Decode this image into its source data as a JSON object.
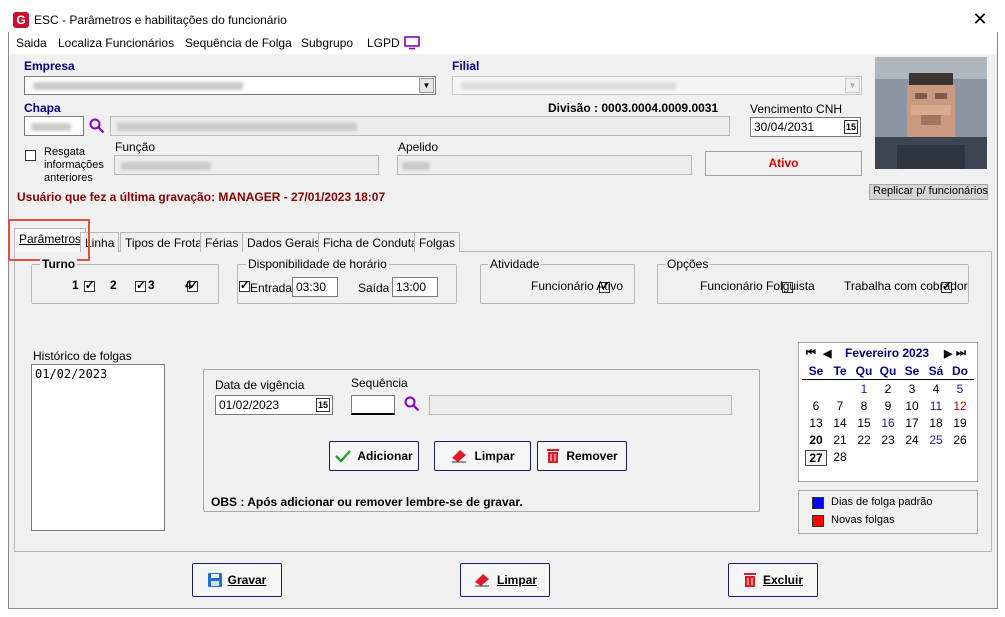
{
  "window": {
    "title": "ESC - Parâmetros e habilitações do funcionário",
    "logo": "G"
  },
  "menu": [
    {
      "label": "Saida"
    },
    {
      "label": "Localiza Funcionários"
    },
    {
      "label": "Sequência de Folga"
    },
    {
      "label": "Subgrupo"
    },
    {
      "label": "LGPD"
    }
  ],
  "header": {
    "empresa_label": "Empresa",
    "filial_label": "Filial",
    "chapa_label": "Chapa",
    "divisao": "Divisão : 0003.0004.0009.0031",
    "vencimento_label": "Vencimento  CNH",
    "vencimento_value": "30/04/2031",
    "funcao_label": "Função",
    "apelido_label": "Apelido",
    "resgata_label_1": "Resgata",
    "resgata_label_2": "informações",
    "resgata_label_3": "anteriores",
    "status": "Ativo",
    "ultima_gravacao": "Usuário que fez a última gravação: MANAGER - 27/01/2023 18:07",
    "replicar_label": "Replicar p/ funcionários"
  },
  "tabs": [
    "Parâmetros",
    "Linha",
    "Tipos de Frota",
    "Férias",
    "Dados Gerais",
    "Ficha de Conduta",
    "Folgas"
  ],
  "turno": {
    "title": "Turno",
    "options": [
      "1",
      "2",
      "3",
      "4"
    ]
  },
  "disponibilidade": {
    "title": "Disponibilidade de horário",
    "entrada_label": "Entrada",
    "entrada_value": "03:30",
    "saida_label": "Saída",
    "saida_value": "13:00"
  },
  "atividade": {
    "title": "Atividade",
    "label": "Funcionário Ativo"
  },
  "opcoes": {
    "title": "Opções",
    "folguista_label": "Funcionário Folguista",
    "cobrador_label": "Trabalha com cobrador"
  },
  "historico": {
    "title": "Histórico de folgas",
    "items": [
      "01/02/2023"
    ]
  },
  "vigencia": {
    "data_label": "Data de vigência",
    "data_value": "01/02/2023",
    "sequencia_label": "Sequência",
    "adicionar": "Adicionar",
    "limpar": "Limpar",
    "remover": "Remover",
    "obs": "OBS : Após adicionar ou  remover lembre-se de gravar."
  },
  "calendar": {
    "month": "Fevereiro 2023",
    "weekdays": [
      "Se",
      "Te",
      "Qu",
      "Qu",
      "Se",
      "Sá",
      "Do"
    ],
    "rows": [
      [
        "",
        "",
        "1",
        "2",
        "3",
        "4",
        "5"
      ],
      [
        "6",
        "7",
        "8",
        "9",
        "10",
        "11",
        "12"
      ],
      [
        "13",
        "14",
        "15",
        "16",
        "17",
        "18",
        "19"
      ],
      [
        "20",
        "21",
        "22",
        "23",
        "24",
        "25",
        "26"
      ],
      [
        "27",
        "28",
        "",
        "",
        "",
        "",
        ""
      ]
    ],
    "legend_padrao": "Dias de folga padrão",
    "legend_novas": "Novas folgas",
    "color_padrao": "#0000ff",
    "color_novas": "#ff0000"
  },
  "footer": {
    "gravar": "Gravar",
    "limpar": "Limpar",
    "excluir": "Excluir"
  },
  "calendar_icon_text": "15"
}
